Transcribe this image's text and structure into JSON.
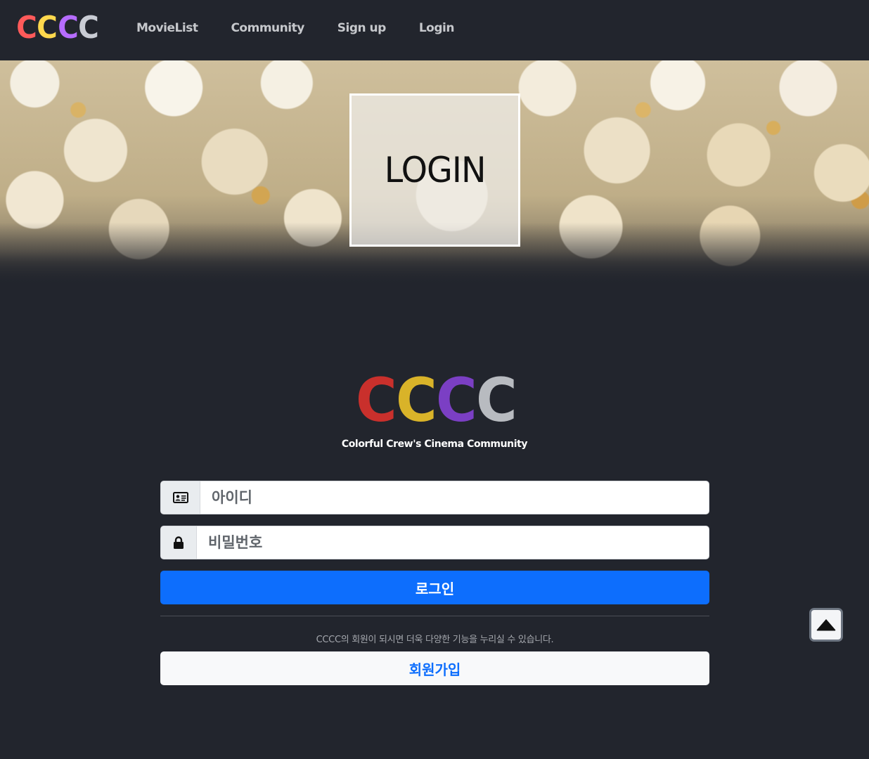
{
  "navbar": {
    "logo": [
      "C",
      "C",
      "C",
      "C"
    ],
    "logo_colors": [
      "#ff5a5a",
      "#ffd84d",
      "#b66cff",
      "#c9ccd4"
    ],
    "links": [
      "MovieList",
      "Community",
      "Sign up",
      "Login"
    ]
  },
  "hero": {
    "title": "LOGIN"
  },
  "brand": {
    "logo": [
      "C",
      "C",
      "C",
      "C"
    ],
    "logo_colors": [
      "#c9302c",
      "#d9b329",
      "#7b3fc4",
      "#b8bbc0"
    ],
    "tagline": "Colorful Crew's Cinema Community"
  },
  "form": {
    "id_placeholder": "아이디",
    "id_icon": "id-card-icon",
    "password_placeholder": "비밀번호",
    "password_icon": "lock-icon",
    "login_label": "로그인",
    "hint": "CCCC의 회원이 되시면 더욱 다양한 기능을 누리실 수 있습니다.",
    "signup_label": "회원가입"
  },
  "scroll_top": {
    "icon": "caret-up-icon"
  },
  "colors": {
    "background": "#22252d",
    "primary": "#0d6efd"
  }
}
